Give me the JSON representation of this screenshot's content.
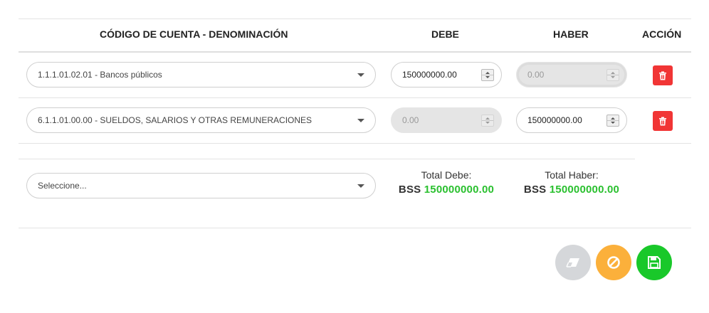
{
  "table": {
    "headers": {
      "account": "CÓDIGO DE CUENTA - DENOMINACIÓN",
      "debit": "DEBE",
      "credit": "HABER",
      "action": "ACCIÓN"
    },
    "rows": [
      {
        "account": "1.1.1.01.02.01 - Bancos públicos",
        "debit": "150000000.00",
        "credit": "0.00",
        "debit_disabled": false,
        "credit_disabled": true
      },
      {
        "account": "6.1.1.01.00.00 - SUELDOS, SALARIOS Y OTRAS REMUNERACIONES",
        "debit": "0.00",
        "credit": "150000000.00",
        "debit_disabled": true,
        "credit_disabled": false
      }
    ]
  },
  "new_entry": {
    "placeholder": "Seleccione..."
  },
  "totals": {
    "debit_label": "Total Debe:",
    "credit_label": "Total Haber:",
    "currency": "BSS",
    "debit_amount": "150000000.00",
    "credit_amount": "150000000.00"
  },
  "icons": {
    "dropdown": "chevron-down-icon",
    "delete": "trash-icon",
    "clear": "eraser-icon",
    "cancel": "ban-icon",
    "save": "floppy-disk-icon"
  },
  "colors": {
    "delete": "#f13535",
    "clear": "#d5d7da",
    "cancel": "#fbb03b",
    "save": "#19c82a",
    "total_amount": "#2ac02f"
  }
}
